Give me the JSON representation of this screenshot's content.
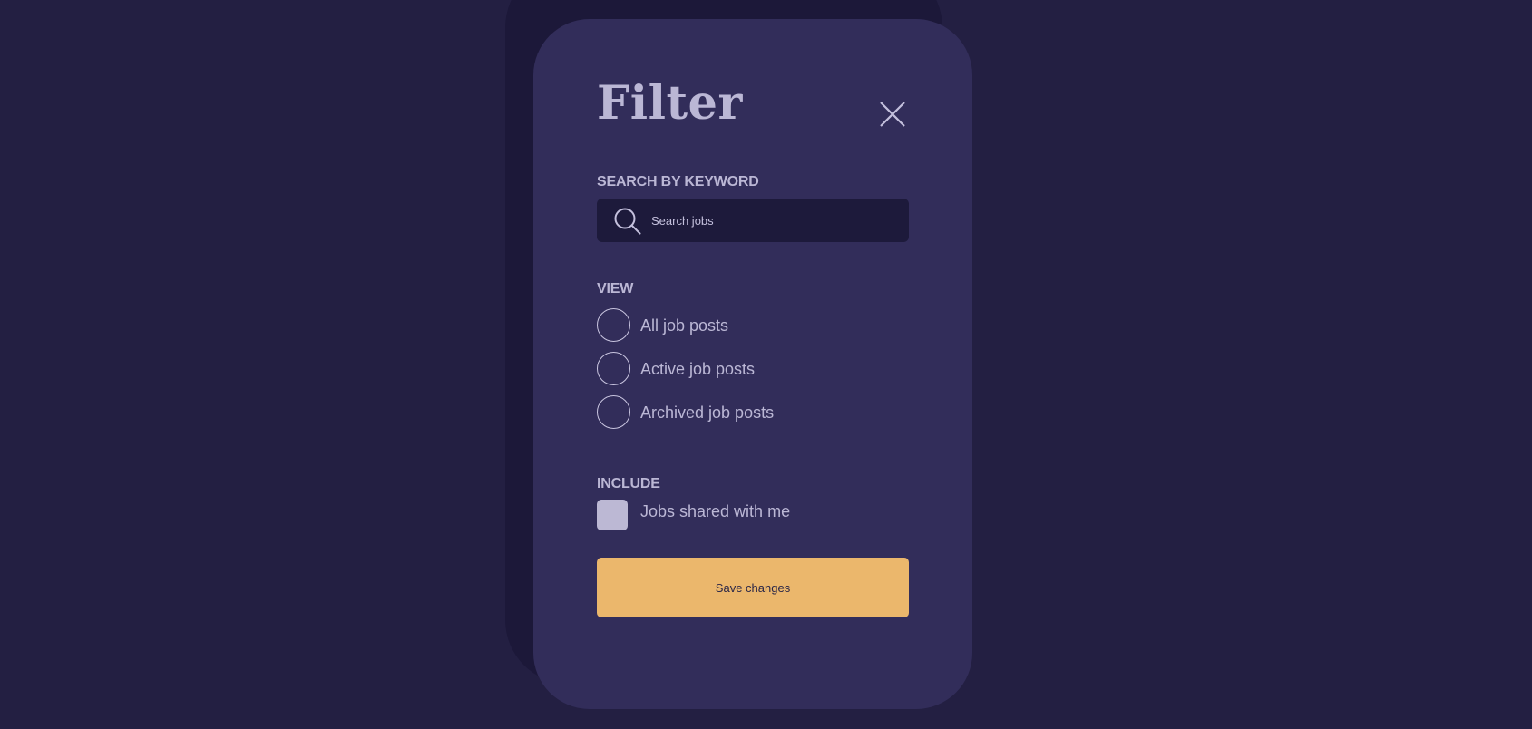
{
  "modal": {
    "title": "Filter",
    "close_icon": "close-icon"
  },
  "search": {
    "label": "SEARCH BY KEYWORD",
    "placeholder": "Search jobs",
    "value": "",
    "icon": "search-icon"
  },
  "view": {
    "label": "VIEW",
    "options": [
      {
        "label": "All job posts",
        "selected": false
      },
      {
        "label": "Active job posts",
        "selected": false
      },
      {
        "label": "Archived job posts",
        "selected": false
      }
    ]
  },
  "include": {
    "label": "INCLUDE",
    "options": [
      {
        "label": "Jobs shared with me",
        "checked": false
      }
    ]
  },
  "actions": {
    "save_label": "Save changes"
  },
  "colors": {
    "page_background": "#231f42",
    "backdrop_card": "#1c1839",
    "modal_background": "#322d5a",
    "text": "#bbb7d5",
    "input_background": "#1d1a3b",
    "accent_button": "#ebb76c",
    "button_text": "#2a2647"
  }
}
